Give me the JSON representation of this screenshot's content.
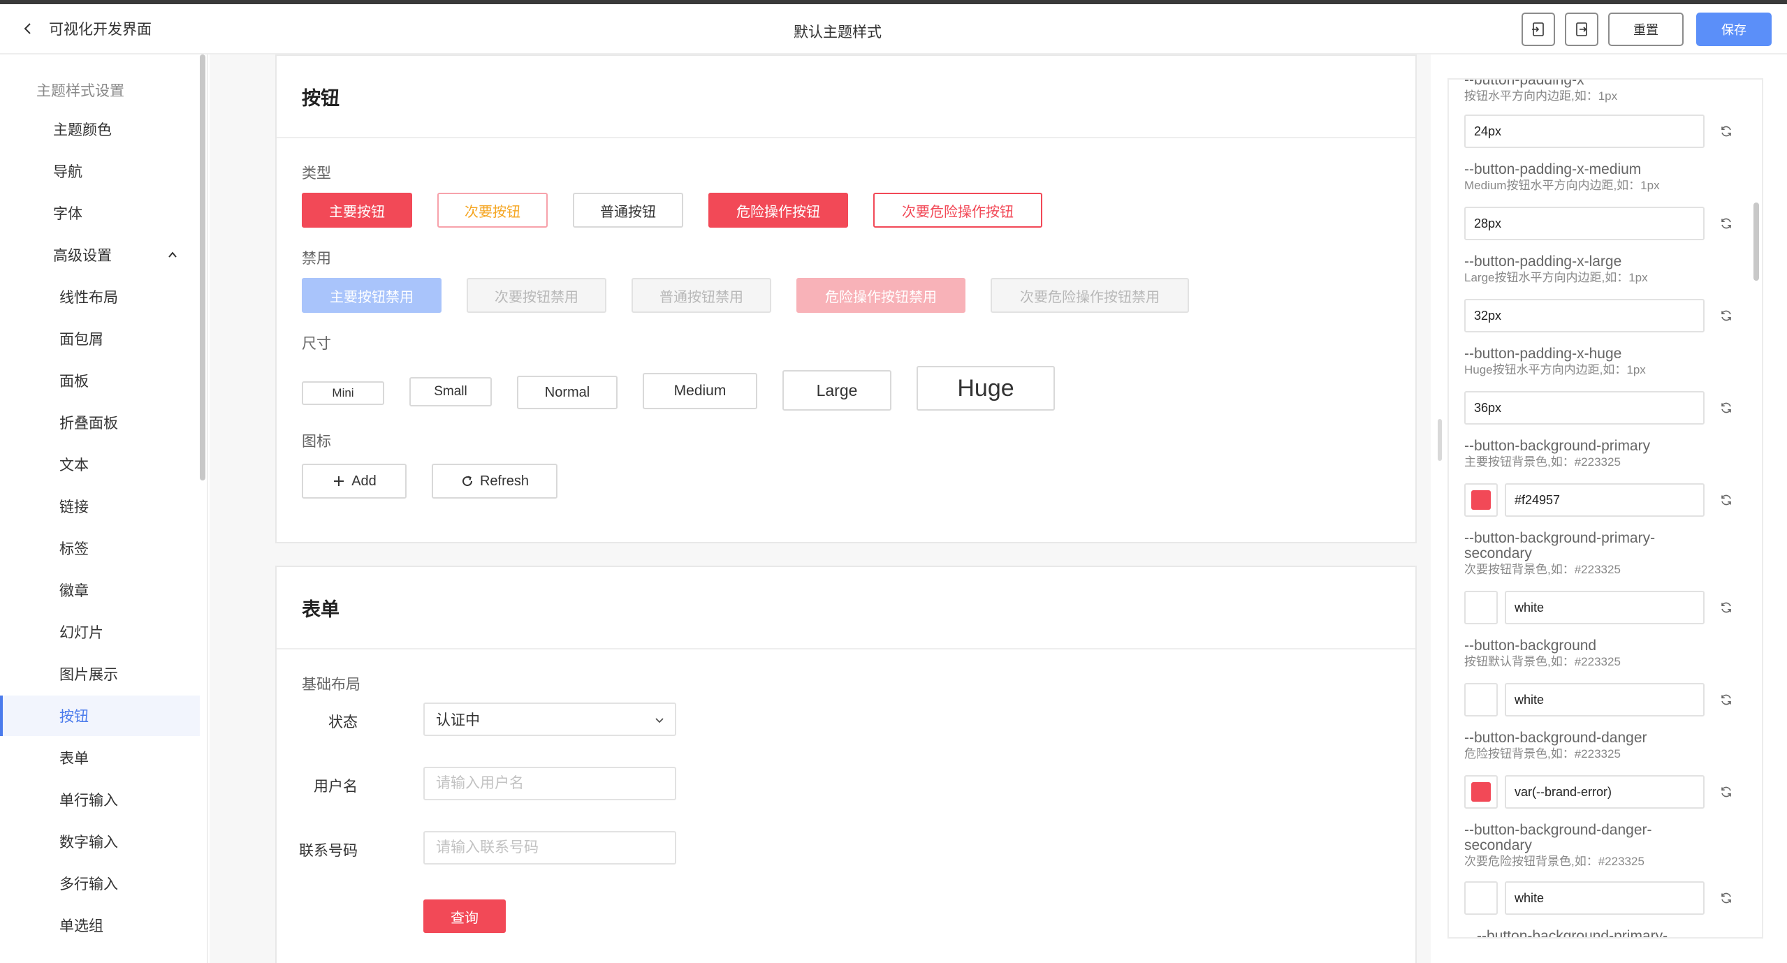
{
  "header": {
    "back_label": "可视化开发界面",
    "title": "默认主题样式",
    "reset_label": "重置",
    "save_label": "保存"
  },
  "colors": {
    "brand_error": "#f24957",
    "primary_blue": "#5b8ff9",
    "secondary_text": "#f5a623"
  },
  "sidebar": {
    "group_title": "主题样式设置",
    "items": [
      {
        "label": "主题颜色"
      },
      {
        "label": "导航"
      },
      {
        "label": "字体"
      },
      {
        "label": "高级设置"
      }
    ],
    "sub_items": [
      {
        "label": "线性布局"
      },
      {
        "label": "面包屑"
      },
      {
        "label": "面板"
      },
      {
        "label": "折叠面板"
      },
      {
        "label": "文本"
      },
      {
        "label": "链接"
      },
      {
        "label": "标签"
      },
      {
        "label": "徽章"
      },
      {
        "label": "幻灯片"
      },
      {
        "label": "图片展示"
      },
      {
        "label": "按钮"
      },
      {
        "label": "表单"
      },
      {
        "label": "单行输入"
      },
      {
        "label": "数字输入"
      },
      {
        "label": "多行输入"
      },
      {
        "label": "单选组"
      }
    ],
    "active_sub": "按钮"
  },
  "button_card": {
    "title": "按钮",
    "type_label": "类型",
    "type_buttons": [
      "主要按钮",
      "次要按钮",
      "普通按钮",
      "危险操作按钮",
      "次要危险操作按钮"
    ],
    "disabled_label": "禁用",
    "disabled_buttons": [
      "主要按钮禁用",
      "次要按钮禁用",
      "普通按钮禁用",
      "危险操作按钮禁用",
      "次要危险操作按钮禁用"
    ],
    "size_label": "尺寸",
    "size_buttons": [
      "Mini",
      "Small",
      "Normal",
      "Medium",
      "Large",
      "Huge"
    ],
    "icon_label": "图标",
    "icon_buttons": [
      "Add",
      "Refresh"
    ]
  },
  "form_card": {
    "title": "表单",
    "layout_label": "基础布局",
    "status_label": "状态",
    "status_value": "认证中",
    "username_label": "用户名",
    "username_placeholder": "请输入用户名",
    "phone_label": "联系号码",
    "phone_placeholder": "请输入联系号码",
    "query_label": "查询"
  },
  "variables": {
    "v0": {
      "name": "--button-padding-x",
      "desc": "按钮水平方向内边距,如：1px",
      "value": "24px"
    },
    "v1": {
      "name": "--button-padding-x-medium",
      "desc": "Medium按钮水平方向内边距,如：1px",
      "value": "28px"
    },
    "v2": {
      "name": "--button-padding-x-large",
      "desc": "Large按钮水平方向内边距,如：1px",
      "value": "32px"
    },
    "v3": {
      "name": "--button-padding-x-huge",
      "desc": "Huge按钮水平方向内边距,如：1px",
      "value": "36px"
    },
    "v4": {
      "name": "--button-background-primary",
      "desc": "主要按钮背景色,如：#223325",
      "value": "#f24957",
      "swatch": "#f24957"
    },
    "v5": {
      "name_line1": "--button-background-primary-",
      "name_line2": "secondary",
      "desc": "次要按钮背景色,如：#223325",
      "value": "white",
      "swatch": "#ffffff"
    },
    "v6": {
      "name": "--button-background",
      "desc": "按钮默认背景色,如：#223325",
      "value": "white",
      "swatch": "#ffffff"
    },
    "v7": {
      "name": "--button-background-danger",
      "desc": "危险按钮背景色,如：#223325",
      "value": "var(--brand-error)",
      "swatch": "#f24957"
    },
    "v8": {
      "name_line1": "--button-background-danger-",
      "name_line2": "secondary",
      "desc": "次要危险按钮背景色,如：#223325",
      "value": "white",
      "swatch": "#ffffff"
    },
    "v9": {
      "name": "--button-background-primary-"
    }
  }
}
